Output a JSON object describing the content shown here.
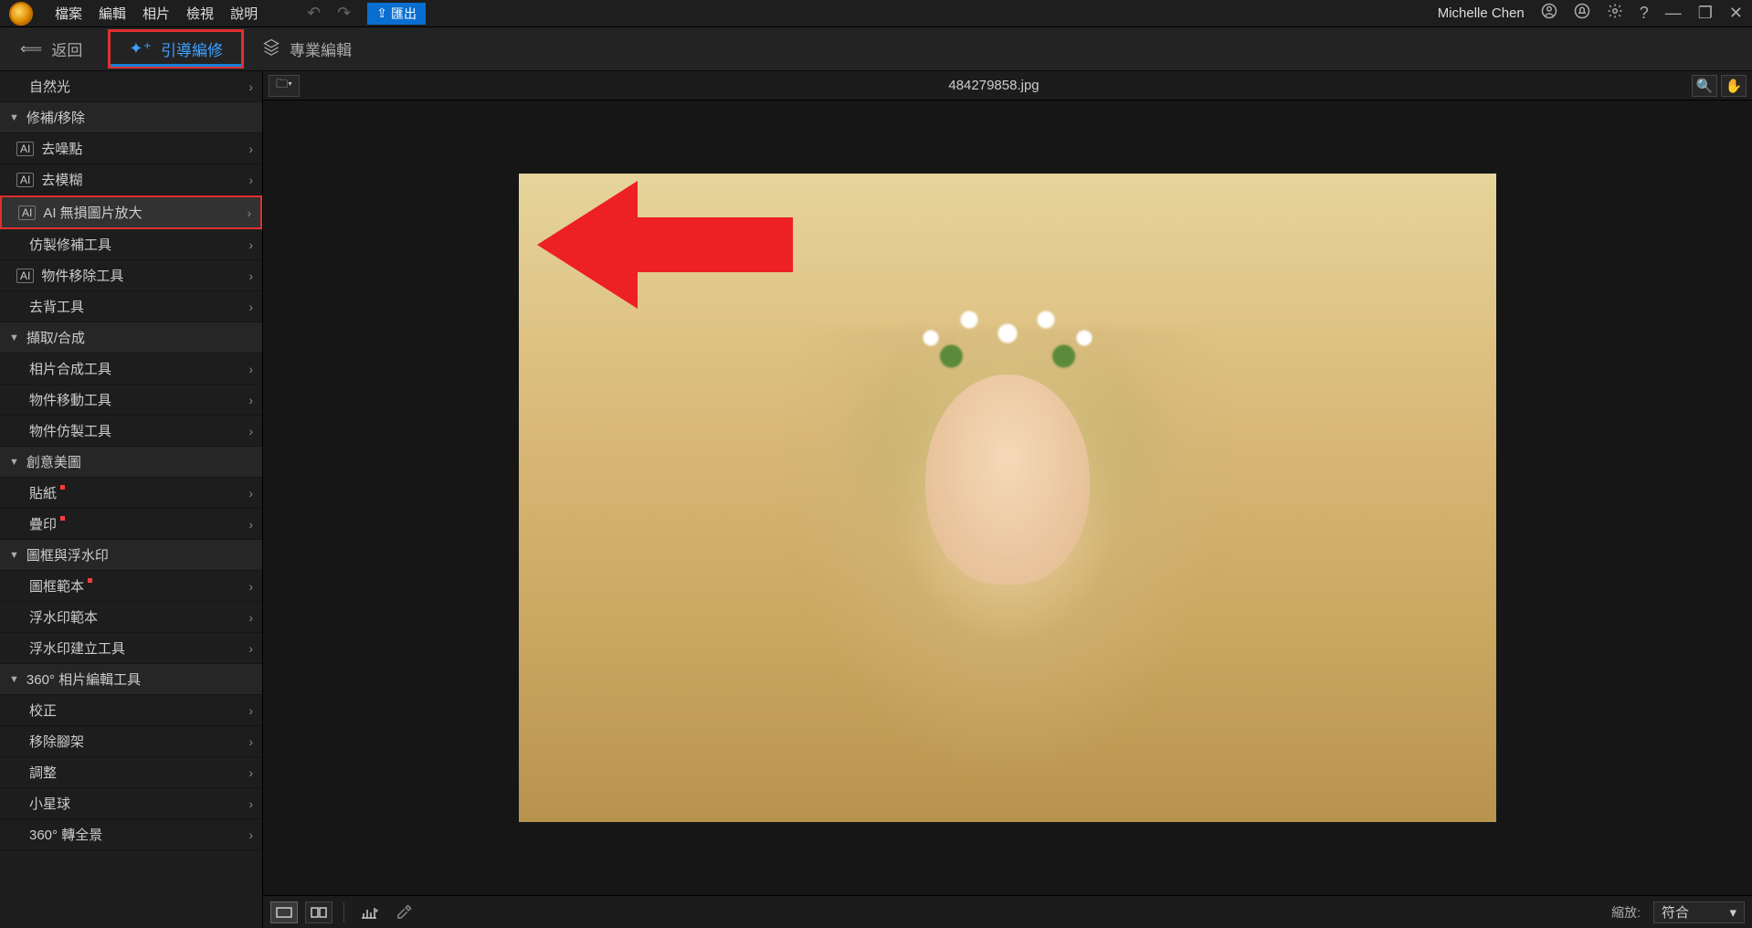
{
  "menu": {
    "items": [
      "檔案",
      "編輯",
      "相片",
      "檢視",
      "說明"
    ],
    "export": "匯出",
    "user": "Michelle Chen"
  },
  "toolbar": {
    "back": "返回",
    "guided": "引導編修",
    "expert": "專業編輯"
  },
  "sidebar": {
    "top_item": "自然光",
    "groups": [
      {
        "title": "修補/移除",
        "items": [
          {
            "label": "去噪點",
            "ai": true
          },
          {
            "label": "去模糊",
            "ai": true
          },
          {
            "label": "AI 無損圖片放大",
            "ai": true,
            "highlight": true
          },
          {
            "label": "仿製修補工具",
            "indent": true
          },
          {
            "label": "物件移除工具",
            "ai": true
          },
          {
            "label": "去背工具",
            "indent": true
          }
        ]
      },
      {
        "title": "擷取/合成",
        "items": [
          {
            "label": "相片合成工具",
            "indent": true
          },
          {
            "label": "物件移動工具",
            "indent": true
          },
          {
            "label": "物件仿製工具",
            "indent": true
          }
        ]
      },
      {
        "title": "創意美圖",
        "items": [
          {
            "label": "貼紙",
            "indent": true,
            "dot": true
          },
          {
            "label": "疊印",
            "indent": true,
            "dot": true
          }
        ]
      },
      {
        "title": "圖框與浮水印",
        "items": [
          {
            "label": "圖框範本",
            "indent": true,
            "dot": true
          },
          {
            "label": "浮水印範本",
            "indent": true
          },
          {
            "label": "浮水印建立工具",
            "indent": true
          }
        ]
      },
      {
        "title": "360° 相片編輯工具",
        "items": [
          {
            "label": "校正",
            "indent": true
          },
          {
            "label": "移除腳架",
            "indent": true
          },
          {
            "label": "調整",
            "indent": true
          },
          {
            "label": "小星球",
            "indent": true
          },
          {
            "label": "360° 轉全景",
            "indent": true
          }
        ]
      }
    ]
  },
  "canvas": {
    "filename": "484279858.jpg"
  },
  "bottombar": {
    "zoom_label": "縮放:",
    "zoom_value": "符合"
  },
  "icons": {
    "ai": "AI"
  }
}
